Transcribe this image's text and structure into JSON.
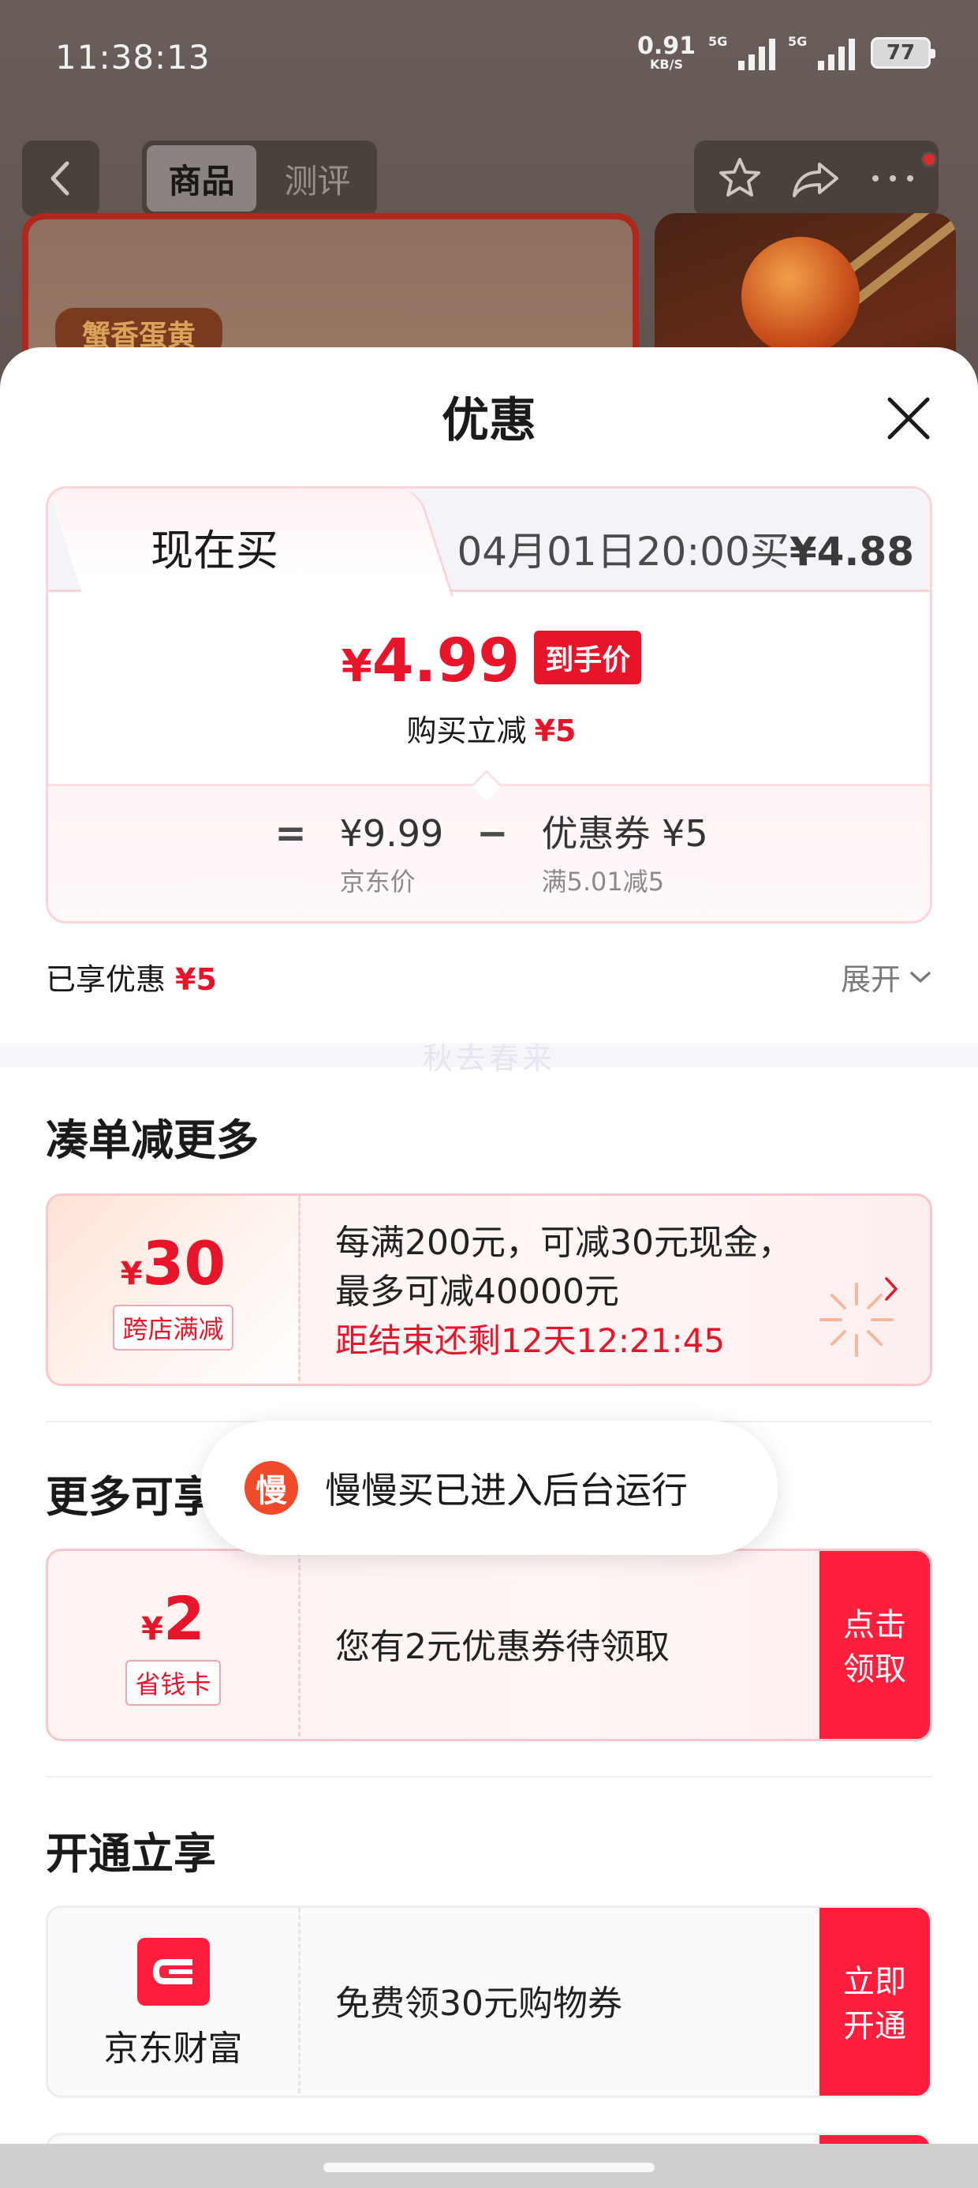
{
  "status_bar": {
    "time": "11:38:13",
    "net_speed": "0.91",
    "net_unit": "KB/S",
    "sim1_label": "5G",
    "sim2_label": "5G",
    "battery": "77"
  },
  "product_nav": {
    "tabs": [
      {
        "label": "商品",
        "active": true
      },
      {
        "label": "测评",
        "active": false
      }
    ],
    "product_tag": "蟹香蛋黄"
  },
  "sheet": {
    "title": "优惠",
    "price_card": {
      "tab_now": "现在买",
      "tab_future_text": "04月01日20:00买",
      "tab_future_price": "¥4.88",
      "final_price_symbol": "¥",
      "final_price": "4.99",
      "final_price_badge": "到手价",
      "reduce_label": "购买立减",
      "reduce_amount": "¥5",
      "calc": {
        "equals": "=",
        "minus": "−",
        "base_price": "¥9.99",
        "base_label": "京东价",
        "coupon_value": "优惠券 ¥5",
        "coupon_rule": "满5.01减5"
      }
    },
    "enjoyed_label": "已享优惠",
    "enjoyed_amount": "¥5",
    "expand_label": "展开",
    "watermark": "秋去春来",
    "section_combine": {
      "title": "凑单减更多",
      "offer": {
        "symbol": "¥",
        "amount": "30",
        "tag": "跨店满减",
        "line1": "每满200元，可减30元现金，",
        "line2": "最多可减40000元",
        "countdown": "距结束还剩12天12:21:45"
      }
    },
    "section_more": {
      "title": "更多可享优惠",
      "offer": {
        "symbol": "¥",
        "amount": "2",
        "tag": "省钱卡",
        "text": "您有2元优惠券待领取",
        "button_line1": "点击",
        "button_line2": "领取"
      }
    },
    "section_open": {
      "title": "开通立享",
      "offer": {
        "brand": "京东财富",
        "text": "免费领30元购物券",
        "button_line1": "立即",
        "button_line2": "开通"
      }
    }
  },
  "toast": {
    "icon_char": "慢",
    "text": "慢慢买已进入后台运行"
  },
  "colors": {
    "accent_red": "#e8152a",
    "button_red": "#ff1e3c",
    "card_border": "#fbd3d8"
  }
}
